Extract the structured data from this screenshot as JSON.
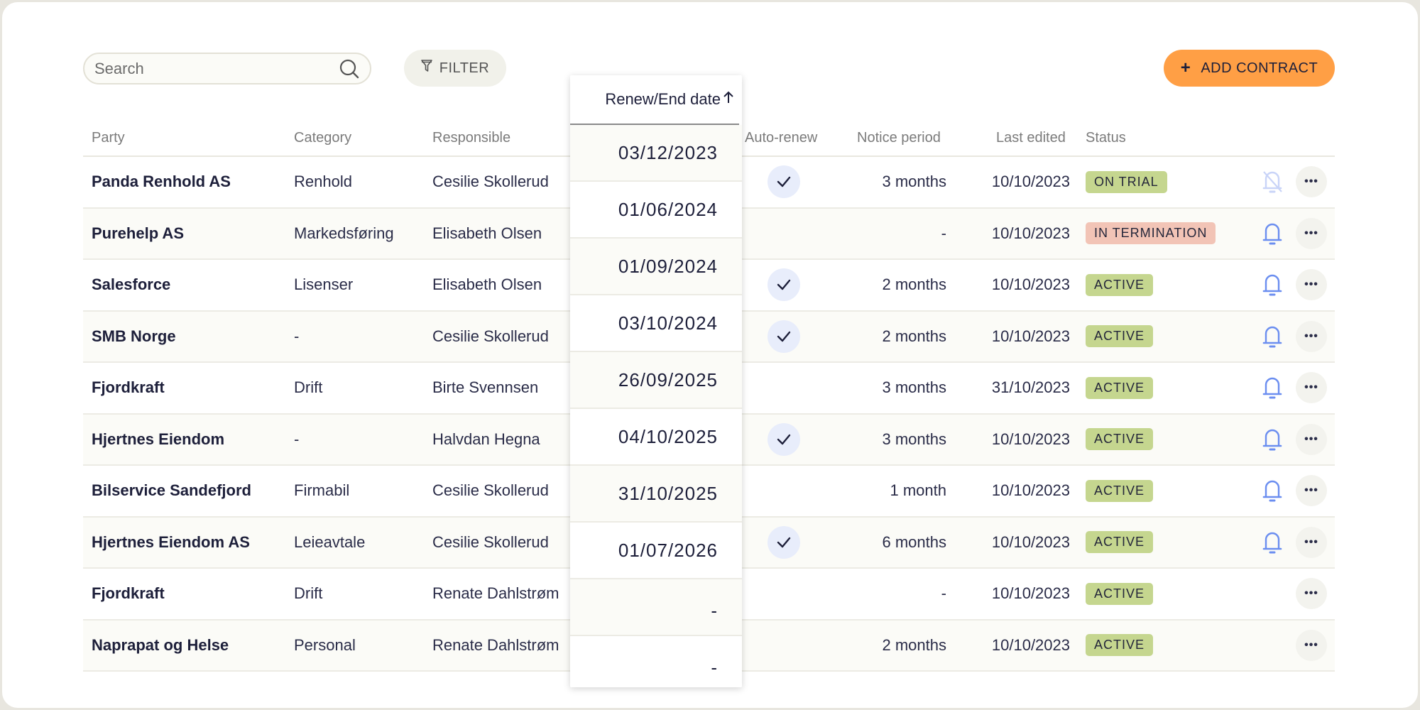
{
  "toolbar": {
    "search_placeholder": "Search",
    "search_value": "",
    "filter_label": "FILTER",
    "add_label": "ADD CONTRACT",
    "add_color": "#ff9f45"
  },
  "table": {
    "columns": {
      "party": "Party",
      "category": "Category",
      "responsible": "Responsible",
      "renew_end_date": "Renew/End date",
      "auto_renew": "Auto-renew",
      "notice_period": "Notice period",
      "last_edited": "Last edited",
      "status": "Status"
    },
    "sort": {
      "column": "renew_end_date",
      "direction": "ascending",
      "icon": "arrow-up-icon"
    },
    "rows": [
      {
        "party": "Panda Renhold AS",
        "category": "Renhold",
        "responsible": "Cesilie Skollerud",
        "renew_end_date": "03/12/2023",
        "auto_renew": true,
        "notice_period": "3 months",
        "last_edited": "10/10/2023",
        "status": "ON TRIAL",
        "bell": "bell-off"
      },
      {
        "party": "Purehelp AS",
        "category": "Markedsføring",
        "responsible": "Elisabeth Olsen",
        "renew_end_date": "01/06/2024",
        "auto_renew": false,
        "notice_period": "-",
        "last_edited": "10/10/2023",
        "status": "IN TERMINATION",
        "bell": "bell"
      },
      {
        "party": "Salesforce",
        "category": "Lisenser",
        "responsible": "Elisabeth Olsen",
        "renew_end_date": "01/09/2024",
        "auto_renew": true,
        "notice_period": "2 months",
        "last_edited": "10/10/2023",
        "status": "ACTIVE",
        "bell": "bell"
      },
      {
        "party": "SMB Norge",
        "category": "-",
        "responsible": "Cesilie Skollerud",
        "renew_end_date": "03/10/2024",
        "auto_renew": true,
        "notice_period": "2 months",
        "last_edited": "10/10/2023",
        "status": "ACTIVE",
        "bell": "bell"
      },
      {
        "party": "Fjordkraft",
        "category": "Drift",
        "responsible": "Birte Svennsen",
        "renew_end_date": "26/09/2025",
        "auto_renew": false,
        "notice_period": "3 months",
        "last_edited": "31/10/2023",
        "status": "ACTIVE",
        "bell": "bell"
      },
      {
        "party": "Hjertnes Eiendom",
        "category": "-",
        "responsible": "Halvdan Hegna",
        "renew_end_date": "04/10/2025",
        "auto_renew": true,
        "notice_period": "3 months",
        "last_edited": "10/10/2023",
        "status": "ACTIVE",
        "bell": "bell"
      },
      {
        "party": "Bilservice Sandefjord",
        "category": "Firmabil",
        "responsible": "Cesilie Skollerud",
        "renew_end_date": "31/10/2025",
        "auto_renew": false,
        "notice_period": "1 month",
        "last_edited": "10/10/2023",
        "status": "ACTIVE",
        "bell": "bell"
      },
      {
        "party": "Hjertnes Eiendom AS",
        "category": "Leieavtale",
        "responsible": "Cesilie Skollerud",
        "renew_end_date": "01/07/2026",
        "auto_renew": true,
        "notice_period": "6 months",
        "last_edited": "10/10/2023",
        "status": "ACTIVE",
        "bell": "bell"
      },
      {
        "party": "Fjordkraft",
        "category": "Drift",
        "responsible": "Renate Dahlstrøm",
        "renew_end_date": "-",
        "auto_renew": false,
        "notice_period": "-",
        "last_edited": "10/10/2023",
        "status": "ACTIVE",
        "bell": "none"
      },
      {
        "party": "Naprapat og Helse",
        "category": "Personal",
        "responsible": "Renate Dahlstrøm",
        "renew_end_date": "-",
        "auto_renew": false,
        "notice_period": "2 months",
        "last_edited": "10/10/2023",
        "status": "ACTIVE",
        "bell": "none"
      }
    ]
  },
  "colors": {
    "status_active": "#c5d68f",
    "status_on_trial": "#c5d68f",
    "status_in_termination": "#f2c4b6",
    "bell_active": "#6b8ef0",
    "bell_muted": "#c9d4f8",
    "check_bg": "#e8edfb"
  }
}
